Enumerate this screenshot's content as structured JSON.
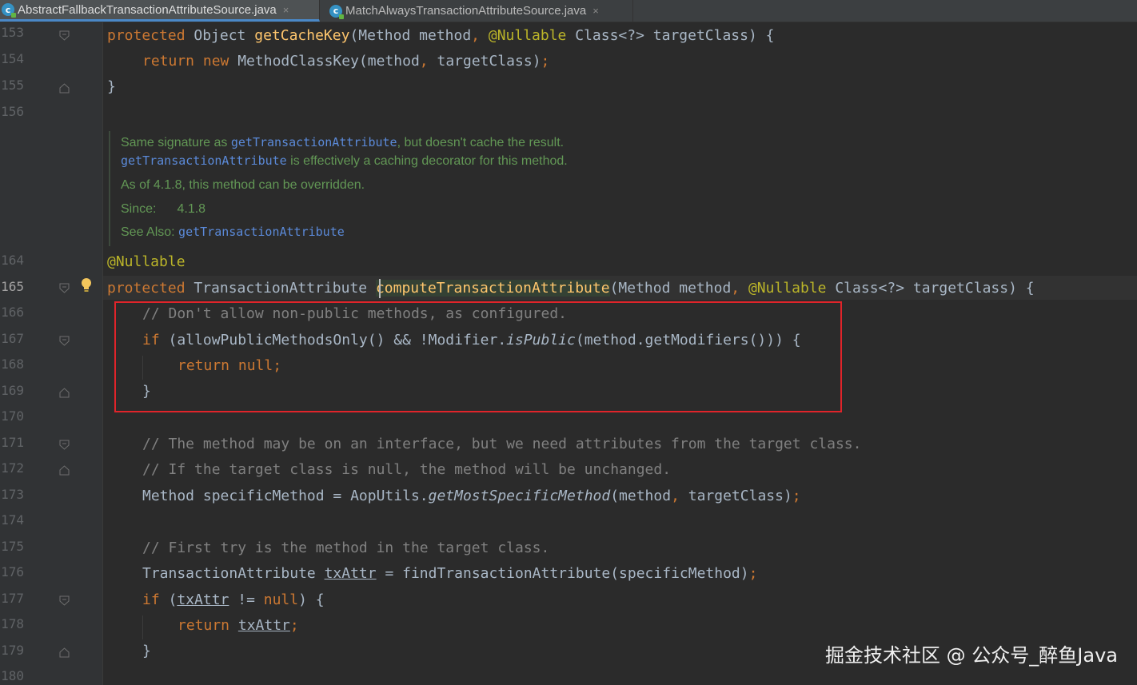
{
  "tabs": [
    {
      "icon": "c",
      "label": "AbstractFallbackTransactionAttributeSource.java",
      "close": "×",
      "active": true
    },
    {
      "icon": "c",
      "label": "MatchAlwaysTransactionAttributeSource.java",
      "close": "×",
      "active": false
    }
  ],
  "line_numbers": {
    "l153": "153",
    "l154": "154",
    "l155": "155",
    "l156": "156",
    "l164": "164",
    "l165": "165",
    "l166": "166",
    "l167": "167",
    "l168": "168",
    "l169": "169",
    "l170": "170",
    "l171": "171",
    "l172": "172",
    "l173": "173",
    "l174": "174",
    "l175": "175",
    "l176": "176",
    "l177": "177",
    "l178": "178",
    "l179": "179",
    "l180": "180"
  },
  "doc": {
    "line1_a": "Same signature as ",
    "line1_link": "getTransactionAttribute",
    "line1_b": ", but doesn't cache the result.",
    "line2_link": "getTransactionAttribute",
    "line2_b": " is effectively a caching decorator for this method.",
    "line3": "As of 4.1.8, this method can be overridden.",
    "since_label": "Since:",
    "since_value": "4.1.8",
    "see_also_label": "See Also: ",
    "see_also_link": "getTransactionAttribute"
  },
  "code": {
    "c153": {
      "k1": "protected ",
      "t1": "Object ",
      "fn": "getCacheKey",
      "p1": "(Method method",
      "sep": ", ",
      "ann": "@Nullable ",
      "p2": "Class<?> targetClass) {"
    },
    "c154": {
      "k1": "return ",
      "k2": "new ",
      "t1": "MethodClassKey(method",
      "sep": ", ",
      "t2": "targetClass)",
      "semi": ";"
    },
    "c155": "}",
    "c164": "@Nullable",
    "c165": {
      "k1": "protected ",
      "t1": "TransactionAttribute ",
      "fn": "computeTransactionAttribute",
      "p1": "(Method method",
      "sep": ", ",
      "ann": "@Nullable ",
      "p2": "Class<?> targetClass) {"
    },
    "c166": "// Don't allow non-public methods, as configured.",
    "c167": {
      "k1": "if ",
      "t1": "(allowPublicMethodsOnly() && !Modifier.",
      "it": "isPublic",
      "t2": "(method.getModifiers())) {"
    },
    "c168": {
      "k1": "return null",
      "semi": ";"
    },
    "c169": "}",
    "c171": "// The method may be on an interface, but we need attributes from the target class.",
    "c172": "// If the target class is null, the method will be unchanged.",
    "c173": {
      "t1": "Method specificMethod = AopUtils.",
      "it": "getMostSpecificMethod",
      "t2": "(method",
      "sep": ", ",
      "t3": "targetClass)",
      "semi": ";"
    },
    "c175": "// First try is the method in the target class.",
    "c176": {
      "t1": "TransactionAttribute ",
      "ul": "txAttr",
      "t2": " = findTransactionAttribute(specificMethod)",
      "semi": ";"
    },
    "c177": {
      "k1": "if ",
      "t1": "(",
      "ul": "txAttr",
      "t2": " != ",
      "k2": "null",
      "t3": ") {"
    },
    "c178": {
      "k1": "return ",
      "ul": "txAttr",
      "semi": ";"
    },
    "c179": "}"
  },
  "watermark": "掘金技术社区 @ 公众号_醉鱼Java"
}
